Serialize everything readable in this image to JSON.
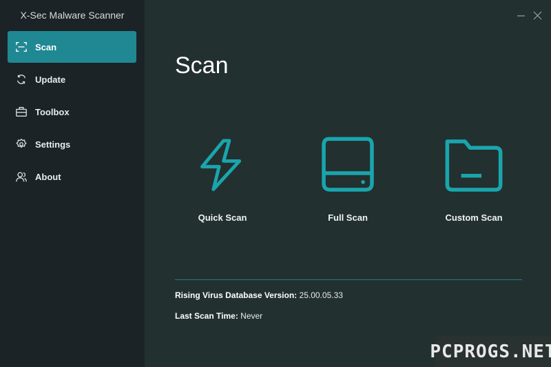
{
  "app": {
    "title": "X-Sec Malware Scanner"
  },
  "sidebar": {
    "items": [
      {
        "label": "Scan",
        "icon": "scan-frame-icon",
        "active": true
      },
      {
        "label": "Update",
        "icon": "refresh-icon",
        "active": false
      },
      {
        "label": "Toolbox",
        "icon": "toolbox-icon",
        "active": false
      },
      {
        "label": "Settings",
        "icon": "gear-icon",
        "active": false
      },
      {
        "label": "About",
        "icon": "people-icon",
        "active": false
      }
    ]
  },
  "main": {
    "title": "Scan",
    "options": [
      {
        "label": "Quick Scan",
        "icon": "lightning-icon"
      },
      {
        "label": "Full Scan",
        "icon": "drive-icon"
      },
      {
        "label": "Custom Scan",
        "icon": "folder-icon"
      }
    ],
    "database_label": "Rising Virus Database Version:",
    "database_value": "25.00.05.33",
    "last_scan_label": "Last Scan Time:",
    "last_scan_value": "Never"
  },
  "watermark": "PCPROGS.NET",
  "colors": {
    "accent": "#1f8893",
    "sidebar_bg": "#1b2326",
    "main_bg": "#233030",
    "icon_teal": "#1aa5ad"
  }
}
